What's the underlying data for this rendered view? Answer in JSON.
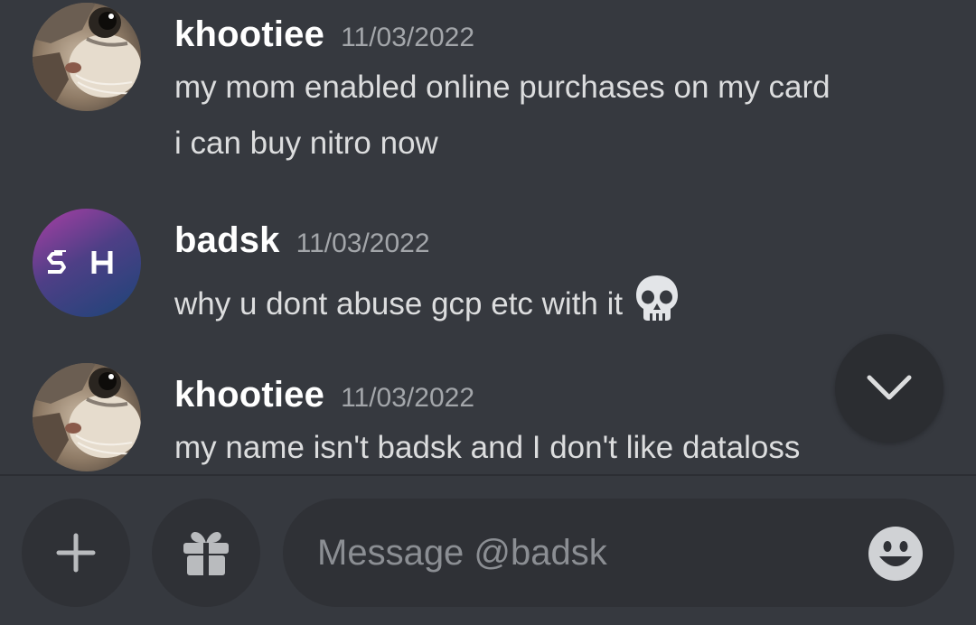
{
  "messages": [
    {
      "author": "khootiee",
      "timestamp": "11/03/2022",
      "avatar_icon": "cat-avatar",
      "lines": [
        "my mom enabled online purchases on my card",
        "i can buy nitro now"
      ]
    },
    {
      "author": "badsk",
      "timestamp": "11/03/2022",
      "avatar_icon": "sh-logo-avatar",
      "lines": [
        "why u dont abuse gcp etc with it"
      ],
      "emoji": "skull-emoji"
    },
    {
      "author": "khootiee",
      "timestamp": "11/03/2022",
      "avatar_icon": "cat-avatar",
      "lines": [
        "my name isn't badsk and I don't like dataloss"
      ]
    }
  ],
  "composer": {
    "placeholder": "Message @badsk",
    "value": ""
  },
  "icons": {
    "add": "plus-icon",
    "gift": "gift-icon",
    "emoji": "smiley-icon",
    "scroll": "chevron-down-icon"
  },
  "colors": {
    "background": "#36393f",
    "input": "#2f3136",
    "username": "#ffffff",
    "timestamp": "#a3a6aa",
    "text": "#dcddde"
  }
}
